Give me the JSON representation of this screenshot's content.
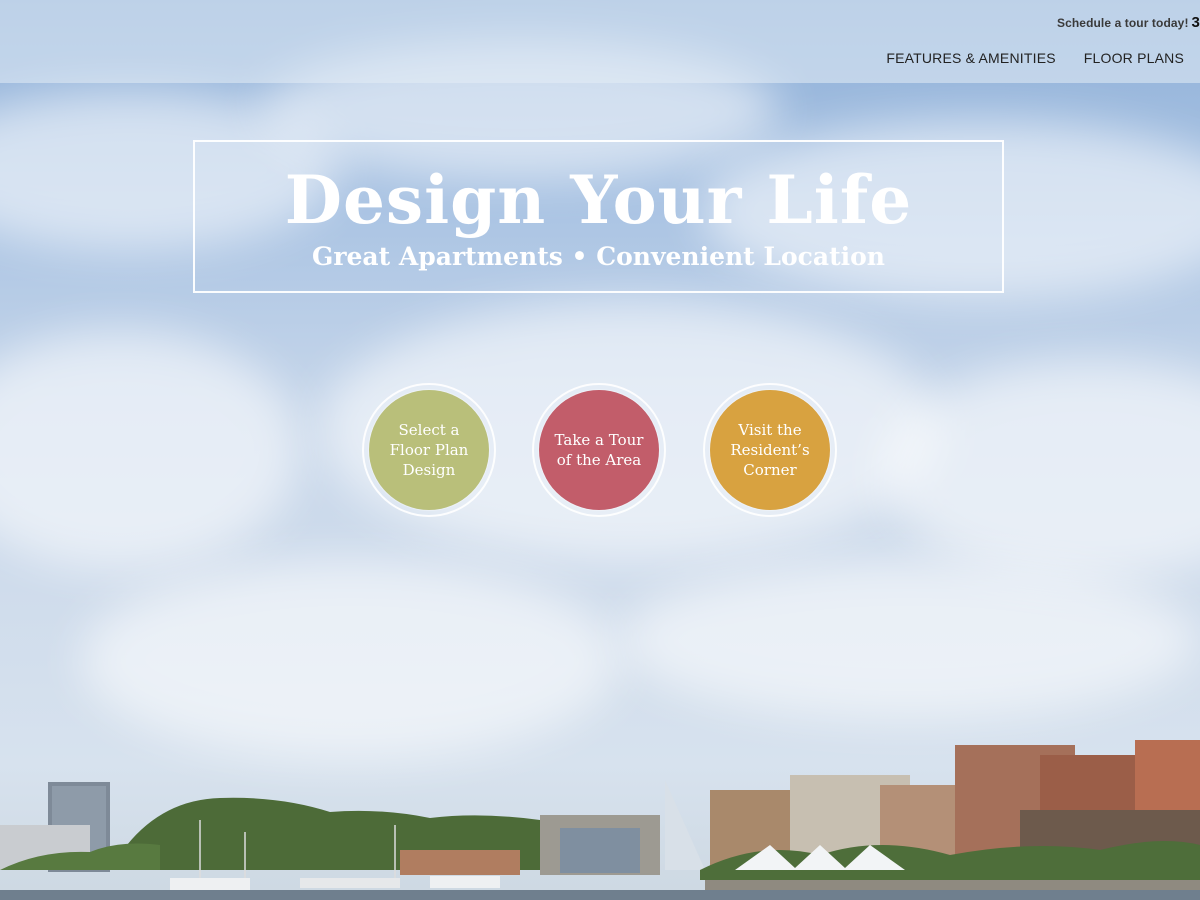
{
  "header": {
    "cta_text": "Schedule a tour today!",
    "cta_phone_fragment": "3",
    "nav": [
      {
        "label": "FEATURES & AMENITIES"
      },
      {
        "label": "FLOOR PLANS"
      }
    ]
  },
  "hero": {
    "title": "Design Your Life",
    "subtitle": "Great Apartments • Convenient Location"
  },
  "actions": [
    {
      "label": "Select a\nFloor Plan\nDesign",
      "color": "#b9bf7a"
    },
    {
      "label": "Take a Tour\nof the Area",
      "color": "#c25d6a"
    },
    {
      "label": "Visit the\nResident’s\nCorner",
      "color": "#d8a240"
    }
  ],
  "colors": {
    "hero_border": "#ffffff",
    "nav_text": "#222222"
  }
}
